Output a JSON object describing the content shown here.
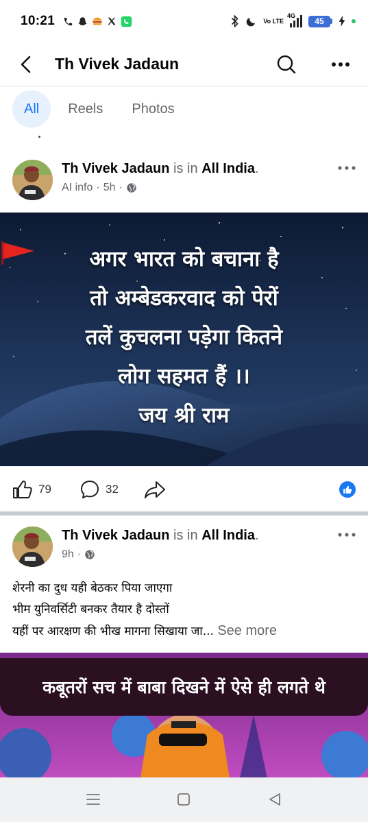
{
  "status_bar": {
    "time": "10:21",
    "network_label": "4G",
    "volte_label": "Vo LTE",
    "battery": "45",
    "left_icons": [
      "phone-icon",
      "snapchat-icon",
      "burger-app-icon",
      "x-icon",
      "whatsapp-icon"
    ],
    "right_icons": [
      "bluetooth-icon",
      "moon-icon",
      "volte-icon",
      "signal-icon",
      "battery-icon",
      "charging-icon"
    ]
  },
  "header": {
    "title": "Th Vivek Jadaun",
    "icons": [
      "back-arrow-icon",
      "search-icon",
      "more-dots-icon"
    ]
  },
  "tabs": [
    {
      "label": "All",
      "active": true
    },
    {
      "label": "Reels",
      "active": false
    },
    {
      "label": "Photos",
      "active": false
    }
  ],
  "posts": [
    {
      "author": "Th Vivek Jadaun",
      "is_in": "is in",
      "location": "All India",
      "meta_label": "AI info",
      "time": "5h",
      "image_text_lines": [
        "अगर भारत को बचाना है",
        "तो अम्बेडकरवाद को पेरों",
        "तलें कुचलना पड़ेगा कितने",
        "लोग सहमत हैं ।।",
        "जय श्री राम"
      ],
      "likes": "79",
      "comments": "32"
    },
    {
      "author": "Th Vivek Jadaun",
      "is_in": "is in",
      "location": "All India",
      "time": "9h",
      "text_lines": [
        "शेरनी का दुध यही बेठकर पिया जाएगा",
        "भीम युनिवर्सिटी बनकर तैयार है दोस्तों",
        "यहीं पर आरक्षण की भीख मागना सिखाया जा..."
      ],
      "see_more": "See more",
      "image_caption": "कबूतरों सच में बाबा दिखने में ऐसे ही लगते थे"
    }
  ],
  "colors": {
    "accent": "#1877f2",
    "tab_active_bg": "#e7f0fd",
    "muted": "#65676b",
    "separator": "#c9ccd1"
  },
  "navbar": {
    "icons": [
      "recent-apps-icon",
      "home-icon",
      "back-icon"
    ]
  }
}
